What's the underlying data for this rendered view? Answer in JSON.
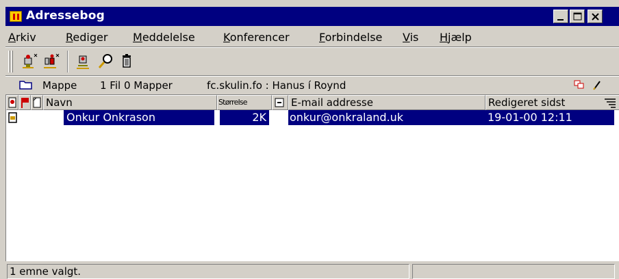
{
  "window": {
    "title": "Adressebog"
  },
  "menu": [
    {
      "label": "Arkiv",
      "key": "A",
      "rest": "rkiv"
    },
    {
      "label": "Rediger",
      "key": "R",
      "rest": "ediger"
    },
    {
      "label": "Meddelelse",
      "key": "M",
      "rest": "eddelelse"
    },
    {
      "label": "Konferencer",
      "key": "K",
      "rest": "onferencer"
    },
    {
      "label": "Forbindelse",
      "key": "F",
      "rest": "orbindelse"
    },
    {
      "label": "Vis",
      "key": "V",
      "rest": "is"
    },
    {
      "label": "Hjælp",
      "key": "H",
      "rest": "jælp"
    }
  ],
  "toolbar": {
    "tools": [
      "new-contact-icon",
      "new-group-icon",
      "properties-icon",
      "search-icon",
      "delete-icon"
    ]
  },
  "pathbar": {
    "folder_label": "Mappe",
    "counts": "1 Fil 0 Mapper",
    "location": "fc.skulin.fo : Hanus í Roynd"
  },
  "list": {
    "columns": [
      "Navn",
      "Størrelse",
      "E-mail addresse",
      "Redigeret sidst"
    ],
    "rows": [
      {
        "name": "Onkur Onkrason",
        "size": "2K",
        "email": "onkur@onkraland.uk",
        "modified": "19-01-00 12:11"
      }
    ]
  },
  "status": {
    "text": "1 emne valgt."
  },
  "colors": {
    "titlebar": "#000080",
    "selection": "#000080",
    "face": "#d4d0c8"
  }
}
